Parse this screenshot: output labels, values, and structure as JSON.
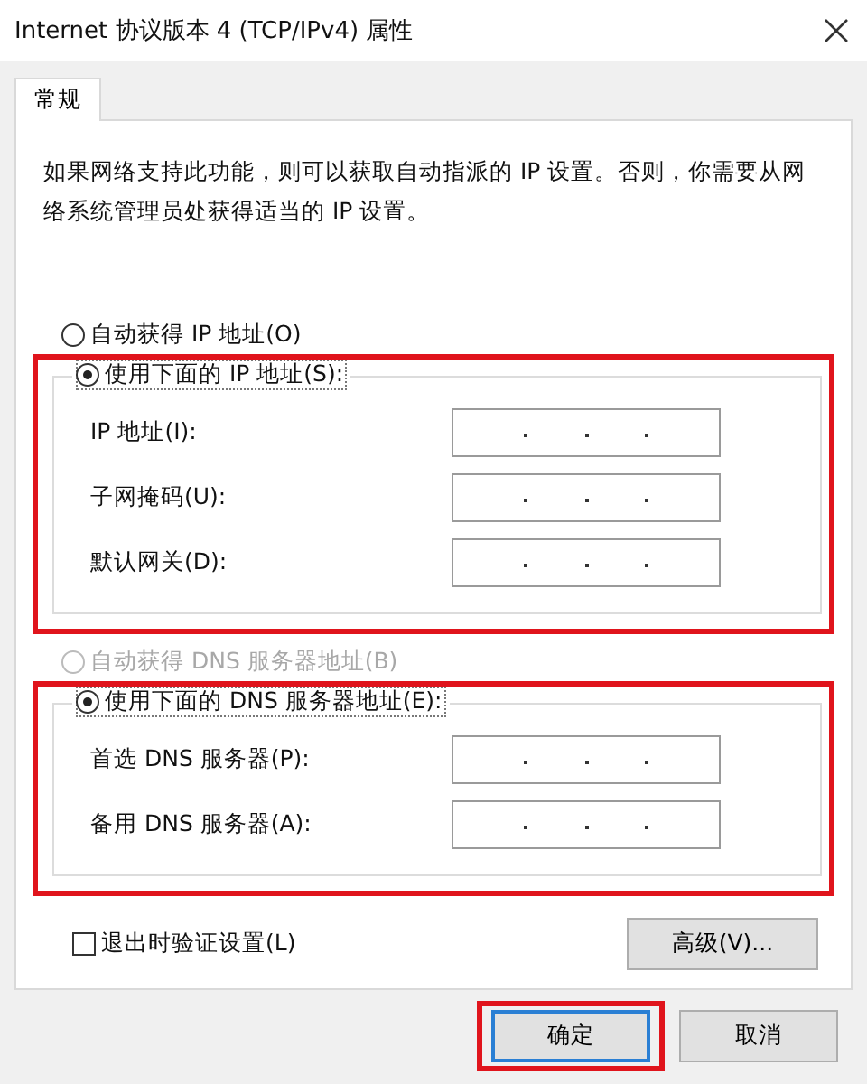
{
  "window": {
    "title": "Internet 协议版本 4 (TCP/IPv4) 属性"
  },
  "tabs": [
    {
      "label": "常规",
      "selected": true
    }
  ],
  "description": "如果网络支持此功能，则可以获取自动指派的 IP 设置。否则，你需要从网络系统管理员处获得适当的 IP 设置。",
  "sections": [
    {
      "auto_option": {
        "label": "自动获得 IP 地址(O)",
        "selected": false,
        "disabled": false
      },
      "manual_option": {
        "label": "使用下面的 IP 地址(S):",
        "selected": true,
        "disabled": false
      },
      "highlighted": true,
      "fields": [
        {
          "label": "IP 地址(I):"
        },
        {
          "label": "子网掩码(U):"
        },
        {
          "label": "默认网关(D):"
        }
      ]
    },
    {
      "auto_option": {
        "label": "自动获得 DNS 服务器地址(B)",
        "selected": false,
        "disabled": true
      },
      "manual_option": {
        "label": "使用下面的 DNS 服务器地址(E):",
        "selected": true,
        "disabled": false
      },
      "highlighted": true,
      "fields": [
        {
          "label": "首选 DNS 服务器(P):"
        },
        {
          "label": "备用 DNS 服务器(A):"
        }
      ]
    }
  ],
  "validate_on_exit": {
    "label": "退出时验证设置(L)",
    "checked": false
  },
  "advanced_button": "高级(V)...",
  "buttons": [
    {
      "label": "确定",
      "default": true,
      "highlighted": true
    },
    {
      "label": "取消",
      "default": false,
      "highlighted": false
    }
  ]
}
